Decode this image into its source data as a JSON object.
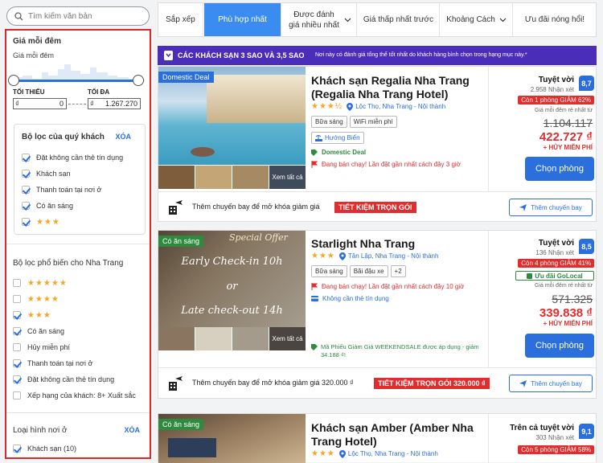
{
  "search": {
    "placeholder": "Tìm kiếm văn bản"
  },
  "filters": {
    "price_title": "Giá mỗi đêm",
    "price_sub": "Giá mỗi đêm",
    "min_label": "TỐI THIỂU",
    "max_label": "TỐI ĐA",
    "currency": "₫",
    "min_value": "0",
    "max_value": "1.267.270",
    "your_filters_title": "Bộ lọc của quý khách",
    "clear_label": "XÓA",
    "your_filters": [
      {
        "label": "Đặt không cần thẻ tín dụng",
        "checked": true
      },
      {
        "label": "Khách sạn",
        "checked": true
      },
      {
        "label": "Thanh toán tại nơi ở",
        "checked": true
      },
      {
        "label": "Có ăn sáng",
        "checked": true
      },
      {
        "label": "★★★",
        "checked": true,
        "stars": true
      }
    ],
    "popular_title": "Bộ lọc phổ biến cho Nha Trang",
    "popular": [
      {
        "label": "★★★★★",
        "checked": false,
        "stars": true
      },
      {
        "label": "★★★★",
        "checked": false,
        "stars": true
      },
      {
        "label": "★★★",
        "checked": true,
        "stars": true
      },
      {
        "label": "Có ăn sáng",
        "checked": true
      },
      {
        "label": "Hủy miễn phí",
        "checked": false
      },
      {
        "label": "Thanh toán tại nơi ở",
        "checked": true
      },
      {
        "label": "Đặt không cần thẻ tín dụng",
        "checked": true
      },
      {
        "label": "Xếp hạng của khách: 8+ Xuất sắc",
        "checked": false
      }
    ],
    "lodging_title": "Loại hình nơi ở",
    "lodging_clear": "XÓA",
    "lodging": [
      {
        "label": "Khách sạn (10)",
        "checked": true
      }
    ]
  },
  "sort_tabs": [
    {
      "label": "Sắp xếp",
      "active": false
    },
    {
      "label": "Phù hợp nhất",
      "active": true
    },
    {
      "label": "Được đánh giá nhiều nhất",
      "active": false,
      "dropdown": true
    },
    {
      "label": "Giá thấp nhất trước",
      "active": false
    },
    {
      "label": "Khoảng Cách",
      "active": false,
      "dropdown": true
    },
    {
      "label": "Ưu đãi nóng hổi!",
      "active": false
    }
  ],
  "banner": {
    "title": "CÁC KHÁCH SẠN 3 SAO VÀ 3,5 SAO",
    "text": "Nơi này có đánh giá tổng thể tốt nhất do khách hàng bình chọn trong hạng mục này.*"
  },
  "hotels": [
    {
      "tag": "Domestic Deal",
      "tag_color": "#2a6fdb",
      "name": "Khách sạn Regalia Nha Trang (Regalia Nha Trang Hotel)",
      "stars": "★★★½",
      "location": "Lộc Thọ, Nha Trang - Nội thành",
      "chips": [
        "Bữa sáng",
        "WiFi miễn phí"
      ],
      "view_chip": "Hướng Biển",
      "deal_label": "Domestic Deal",
      "urgency": "Đang bán chạy! Lần đặt gần nhất cách đây 3 giờ",
      "see_all": "Xem tất cả",
      "rating_label": "Tuyệt vời",
      "reviews": "2.958 Nhận xét",
      "score": "8,7",
      "discount": "Còn 1 phòng GIẢM 62%",
      "price_note": "Giá mỗi đêm rẻ nhất từ",
      "old_price": "1.104.117",
      "new_price": "422.727 ₫",
      "free_cancel": "+ HỦY MIỄN PHÍ",
      "choose": "Chọn phòng",
      "flight_text": "Thêm chuyến bay để mở khóa giảm giá",
      "pkg": "TIẾT KIỆM TRỌN GÓI",
      "flight_btn": "Thêm chuyến bay"
    },
    {
      "tag": "Có ăn sáng",
      "tag_color": "#2e8b3e",
      "name": "Starlight Nha Trang",
      "stars": "★★★",
      "location": "Tân Lập, Nha Trang - Nội thành",
      "chips": [
        "Bữa sáng",
        "Bãi đậu xe",
        "+2"
      ],
      "urgency": "Đang bán chạy! Lần đặt gần nhất cách đây 10 giờ",
      "nocard": "Không cần thẻ tín dụng",
      "promo": "Mã Phiếu Giảm Giá WEEKENDSALE được áp dụng - giảm 34.188 ₫!",
      "photo_text_1": "Special Offer",
      "photo_text_2": "Early Check-in 10h",
      "photo_text_3": "or",
      "photo_text_4": "Late check-out 14h",
      "see_all": "Xem tất cả",
      "rating_label": "Tuyệt vời",
      "reviews": "136 Nhận xét",
      "score": "8,5",
      "discount": "Còn 4 phòng GIẢM 41%",
      "golocal": "Ưu đãi GoLocal",
      "price_note": "Giá mỗi đêm rẻ nhất từ",
      "old_price": "571.325",
      "new_price": "339.838 ₫",
      "free_cancel": "+ HỦY MIỄN PHÍ",
      "choose": "Chọn phòng",
      "flight_text": "Thêm chuyến bay để mở khóa giảm giá 320.000 ₫",
      "pkg": "TIẾT KIỆM TRỌN GÓI 320.000 ₫",
      "flight_btn": "Thêm chuyến bay"
    },
    {
      "tag": "Có ăn sáng",
      "tag_color": "#2e8b3e",
      "name": "Khách sạn Amber (Amber Nha Trang Hotel)",
      "stars": "★★★",
      "location": "Lộc Thọ, Nha Trang - Nội thành",
      "rating_label": "Trên cả tuyệt vời",
      "reviews": "303 Nhận xét",
      "score": "9,1",
      "discount": "Còn 5 phòng GIẢM 58%"
    }
  ],
  "colors": {
    "accent": "#2a6fdb",
    "highlight_border": "#e0262b",
    "banner": "#4a2db8",
    "discount": "#e12d2d"
  }
}
